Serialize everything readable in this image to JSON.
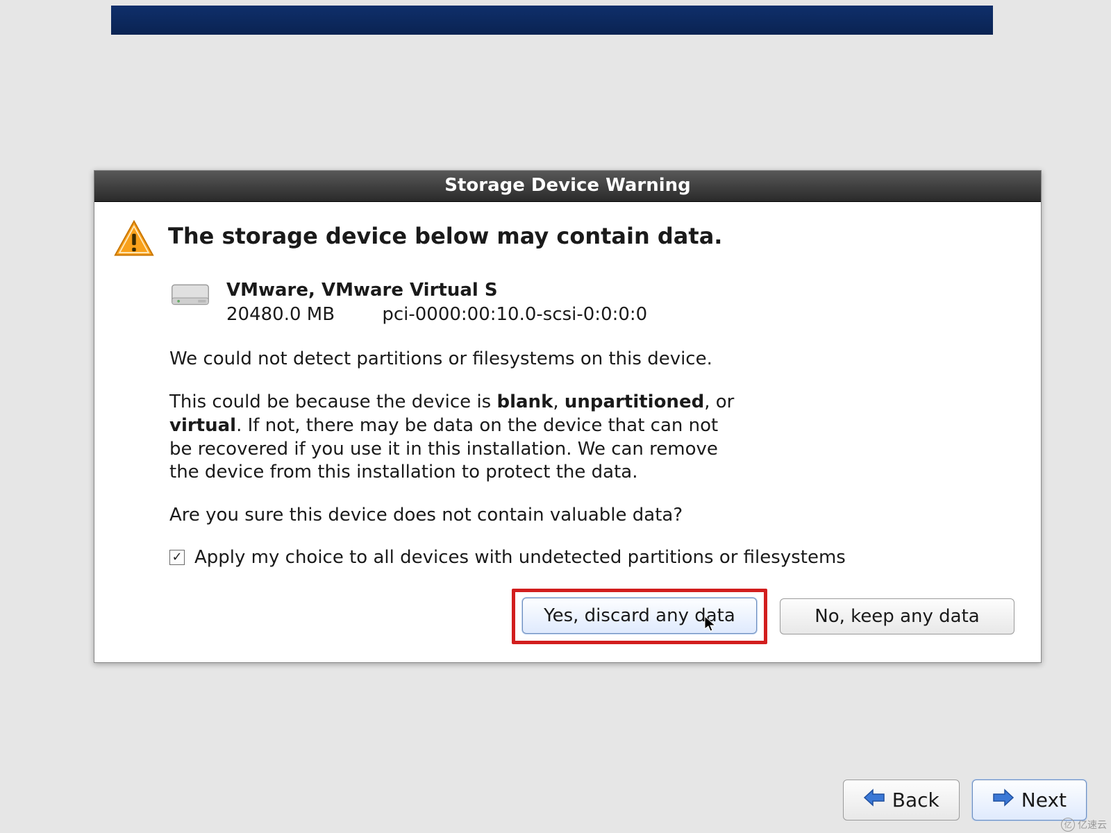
{
  "banner": {},
  "dialog": {
    "title": "Storage Device Warning",
    "heading": "The storage device below may contain data.",
    "device": {
      "name": "VMware, VMware Virtual S",
      "size": "20480.0 MB",
      "path": "pci-0000:00:10.0-scsi-0:0:0:0"
    },
    "text": {
      "line1": "We could not detect partitions or filesystems on this device.",
      "p2_pre": "This could be because the device is ",
      "p2_b1": "blank",
      "p2_mid1": ", ",
      "p2_b2": "unpartitioned",
      "p2_mid2": ", or ",
      "p2_b3": "virtual",
      "p2_post": ". If not, there may be data on the device that can not be recovered if you use it in this installation. We can remove the device from this installation to protect the data.",
      "confirm": "Are you sure this device does not contain valuable data?"
    },
    "checkbox": {
      "checked_glyph": "✓",
      "label": "Apply my choice to all devices with undetected partitions or filesystems"
    },
    "buttons": {
      "yes": "Yes, discard any data",
      "no": "No, keep any data"
    }
  },
  "nav": {
    "back": "Back",
    "next": "Next"
  },
  "watermark": {
    "glyph": "亿",
    "text": "亿速云"
  }
}
